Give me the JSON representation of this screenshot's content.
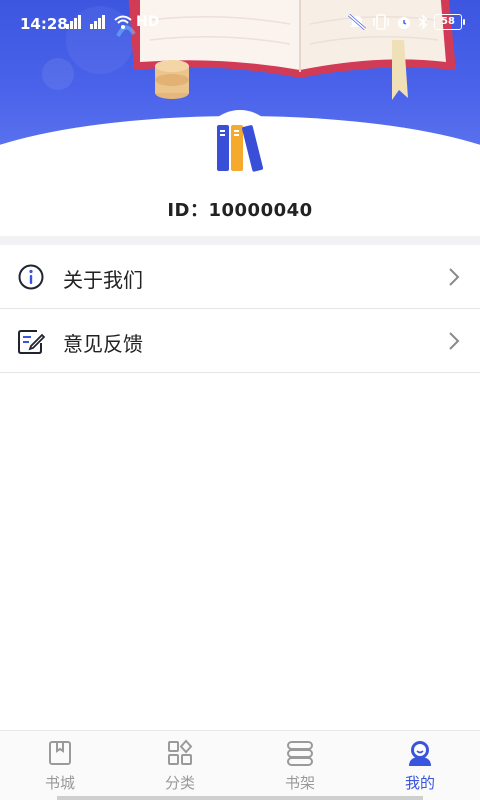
{
  "status_bar": {
    "time": "14:28",
    "network_label": "HD",
    "battery": "58",
    "icons": [
      "signal-icon",
      "wifi-icon",
      "mute-icon",
      "vibrate-icon",
      "alarm-icon",
      "bluetooth-icon",
      "battery-icon"
    ]
  },
  "profile": {
    "user_id": "ID：10000040",
    "avatar_icon": "books-logo-icon"
  },
  "menu": {
    "items": [
      {
        "label": "关于我们",
        "icon": "info-icon"
      },
      {
        "label": "意见反馈",
        "icon": "feedback-edit-icon"
      }
    ]
  },
  "bottom_nav": {
    "items": [
      {
        "label": "书城",
        "icon": "bookstore-icon",
        "active": false
      },
      {
        "label": "分类",
        "icon": "category-icon",
        "active": false
      },
      {
        "label": "书架",
        "icon": "bookshelf-icon",
        "active": false
      },
      {
        "label": "我的",
        "icon": "profile-icon",
        "active": true
      }
    ]
  },
  "colors": {
    "accent": "#3a55dd",
    "banner": "#4a63ea",
    "inactive": "#9a9a9a"
  }
}
